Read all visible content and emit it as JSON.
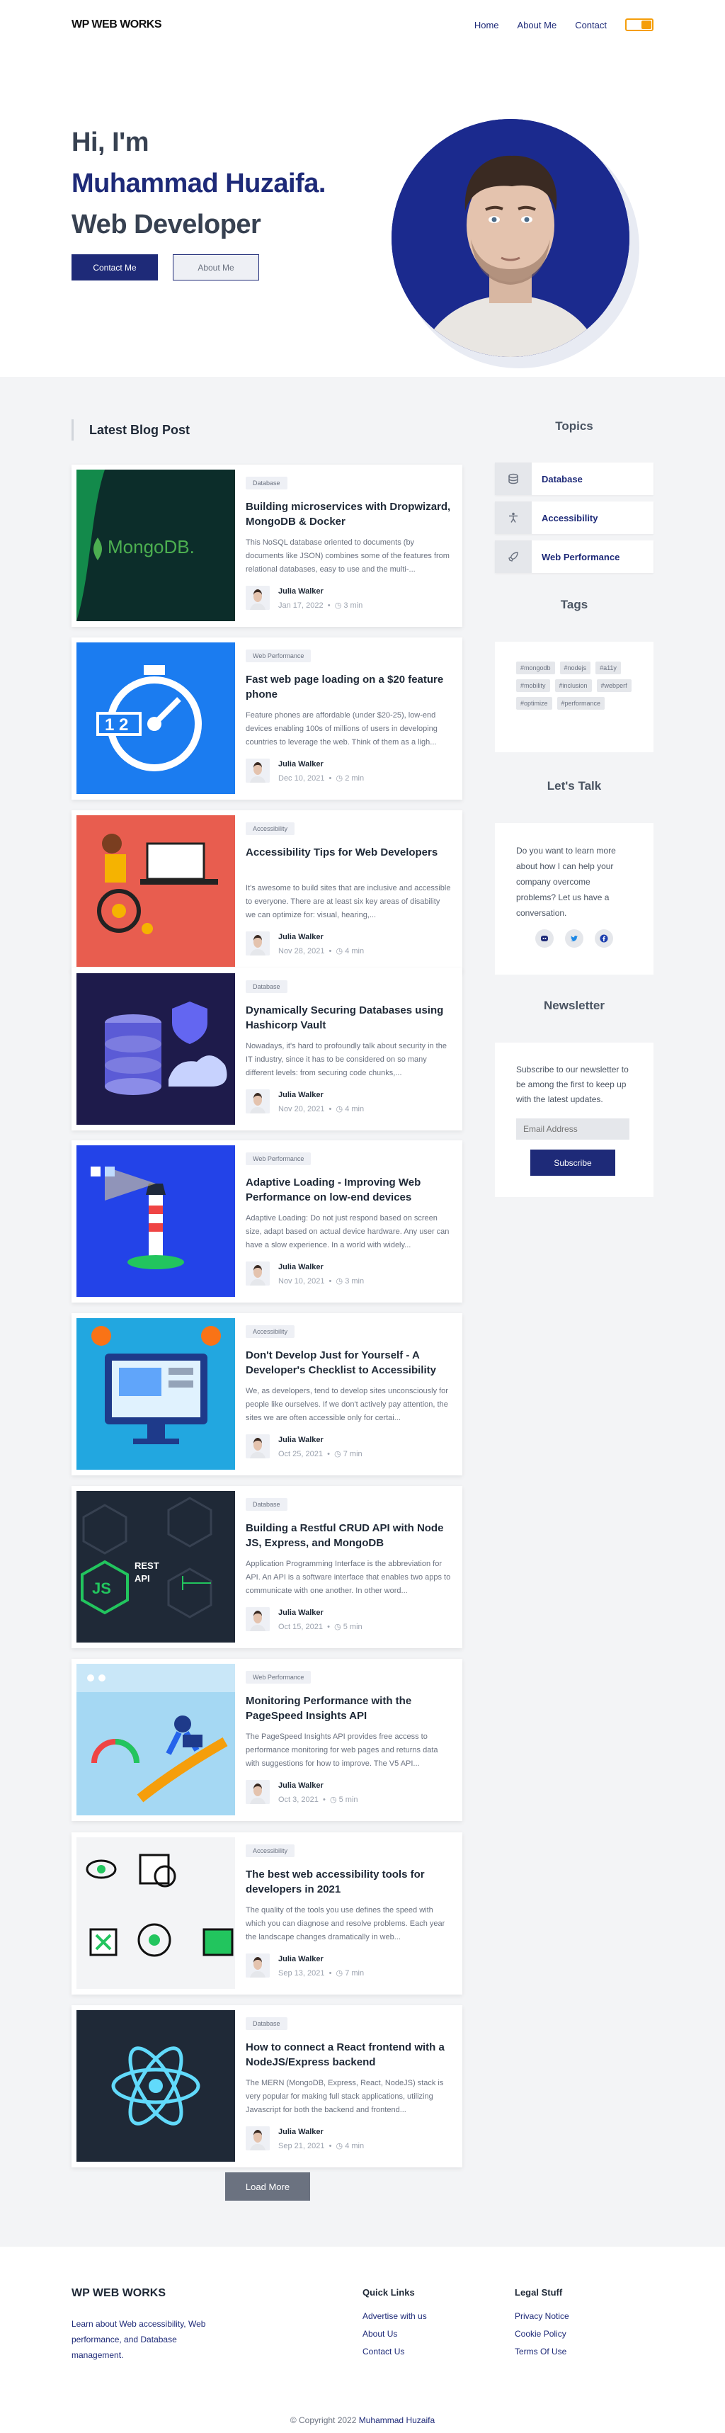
{
  "header": {
    "logo": "WP WEB WORKS",
    "nav": [
      "Home",
      "About Me",
      "Contact"
    ]
  },
  "hero": {
    "greeting": "Hi, I'm",
    "name": "Muhammad Huzaifa.",
    "role": "Web Developer",
    "primary_button": "Contact Me",
    "secondary_button": "About Me"
  },
  "blog": {
    "section_title": "Latest Blog Post",
    "load_more": "Load More",
    "posts": [
      {
        "tag": "Database",
        "title": "Building microservices with Dropwizard, MongoDB & Docker",
        "excerpt": "This NoSQL database oriented to documents (by documents like JSON) combines some of the features from relational databases, easy to use and the multi-...",
        "author": "Julia Walker",
        "date": "Jan 17, 2022",
        "read": "3 min",
        "thumb": "mongodb"
      },
      {
        "tag": "Web Performance",
        "title": "Fast web page loading on a $20 feature phone",
        "excerpt": "Feature phones are affordable (under $20-25), low-end devices enabling 100s of millions of users in developing countries to leverage the web. Think of them as a ligh...",
        "author": "Julia Walker",
        "date": "Dec 10, 2021",
        "read": "2 min",
        "thumb": "stopwatch"
      },
      {
        "tag": "Accessibility",
        "title": "Accessibility Tips for Web Developers",
        "excerpt": "It's awesome to build sites that are inclusive and accessible to everyone. There are at least six key areas of disability we can optimize for: visual, hearing,...",
        "author": "Julia Walker",
        "date": "Nov 28, 2021",
        "read": "4 min",
        "thumb": "wheelchair"
      },
      {
        "tag": "Database",
        "title": "Dynamically Securing Databases using Hashicorp Vault",
        "excerpt": "Nowadays, it's hard to profoundly talk about security in the IT industry, since it has to be considered on so many different levels: from securing code chunks,...",
        "author": "Julia Walker",
        "date": "Nov 20, 2021",
        "read": "4 min",
        "thumb": "vault"
      },
      {
        "tag": "Web Performance",
        "title": "Adaptive Loading - Improving Web Performance on low-end devices",
        "excerpt": "Adaptive Loading: Do not just respond based on screen size, adapt based on actual device hardware. Any user can have a slow experience. In a world with widely...",
        "author": "Julia Walker",
        "date": "Nov 10, 2021",
        "read": "3 min",
        "thumb": "lighthouse"
      },
      {
        "tag": "Accessibility",
        "title": "Don't Develop Just for Yourself - A Developer's Checklist to Accessibility",
        "excerpt": "We, as developers, tend to develop sites unconsciously for people like ourselves. If we don't actively pay attention, the sites we are often accessible only for certai...",
        "author": "Julia Walker",
        "date": "Oct 25, 2021",
        "read": "7 min",
        "thumb": "monitor"
      },
      {
        "tag": "Database",
        "title": "Building a Restful CRUD API with Node JS, Express, and MongoDB",
        "excerpt": "Application Programming Interface is the abbreviation for API. An API is a software interface that enables two apps to communicate with one another. In other word...",
        "author": "Julia Walker",
        "date": "Oct 15, 2021",
        "read": "5 min",
        "thumb": "nodeapi"
      },
      {
        "tag": "Web Performance",
        "title": "Monitoring Performance with the PageSpeed Insights API",
        "excerpt": "The PageSpeed Insights API provides free access to performance monitoring for web pages and returns data with suggestions for how to improve. The V5 API...",
        "author": "Julia Walker",
        "date": "Oct 3, 2021",
        "read": "5 min",
        "thumb": "pagespeed"
      },
      {
        "tag": "Accessibility",
        "title": "The best web accessibility tools for developers in 2021",
        "excerpt": "The quality of the tools you use defines the speed with which you can diagnose and resolve problems. Each year the landscape changes dramatically in web...",
        "author": "Julia Walker",
        "date": "Sep 13, 2021",
        "read": "7 min",
        "thumb": "tools"
      },
      {
        "tag": "Database",
        "title": "How to connect a React frontend with a NodeJS/Express backend",
        "excerpt": "The MERN (MongoDB, Express, React, NodeJS) stack is very popular for making full stack applications, utilizing Javascript for both the backend and frontend...",
        "author": "Julia Walker",
        "date": "Sep 21, 2021",
        "read": "4 min",
        "thumb": "react"
      }
    ]
  },
  "sidebar": {
    "topics_title": "Topics",
    "topics": [
      "Database",
      "Accessibility",
      "Web Performance"
    ],
    "tags_title": "Tags",
    "tags": [
      "#mongodb",
      "#nodejs",
      "#a11y",
      "#mobility",
      "#inclusion",
      "#webperf",
      "#optimize",
      "#performance"
    ],
    "talk_title": "Let's Talk",
    "talk_text": "Do you want to learn more about how I can help your company overcome problems? Let us have a conversation.",
    "newsletter_title": "Newsletter",
    "newsletter_text": "Subscribe to our newsletter to be among the first to keep up with the latest updates.",
    "email_placeholder": "Email Address",
    "subscribe": "Subscribe"
  },
  "footer": {
    "logo": "WP WEB WORKS",
    "description": "Learn about Web accessibility, Web performance, and Database management.",
    "quick_links_title": "Quick Links",
    "quick_links": [
      "Advertise with us",
      "About Us",
      "Contact Us"
    ],
    "legal_title": "Legal Stuff",
    "legal_links": [
      "Privacy Notice",
      "Cookie Policy",
      "Terms Of Use"
    ],
    "copyright_prefix": "© Copyright 2022",
    "copyright_name": "Muhammad Huzaifa"
  },
  "colors": {
    "brand": "#1e2a78",
    "toggle": "#f59e0b",
    "background": "#f3f4f6"
  }
}
